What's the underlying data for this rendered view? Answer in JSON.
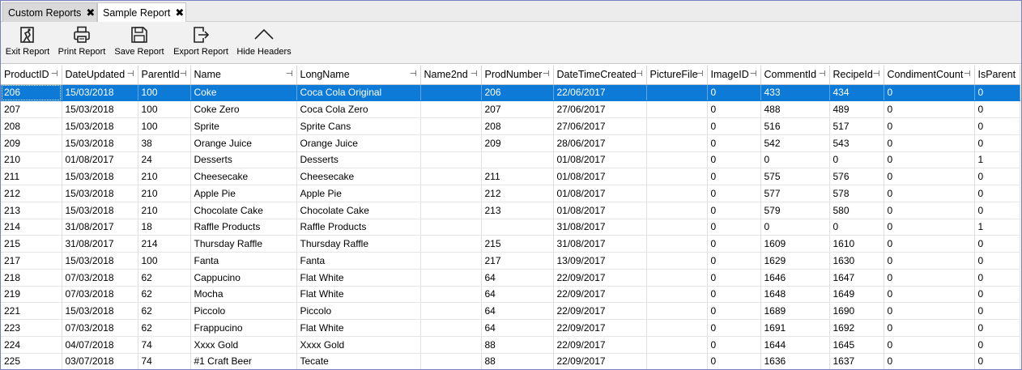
{
  "tabs": [
    {
      "label": "Custom Reports",
      "close": "✖"
    },
    {
      "label": "Sample Report",
      "close": "✖"
    }
  ],
  "toolbar": {
    "exit_label": "Exit Report",
    "print_label": "Print Report",
    "save_label": "Save Report",
    "export_label": "Export Report",
    "hide_label": "Hide Headers"
  },
  "grid": {
    "pin_glyph": "⊣",
    "columns": [
      "ProductID",
      "DateUpdated",
      "ParentId",
      "Name",
      "LongName",
      "Name2nd",
      "ProdNumber",
      "DateTimeCreated",
      "PictureFile",
      "ImageID",
      "CommentId",
      "RecipeId",
      "CondimentCount",
      "IsParent"
    ],
    "selected_row": 0,
    "rows": [
      [
        "206",
        "15/03/2018",
        "100",
        "Coke",
        "Coca Cola Original",
        "",
        "206",
        "22/06/2017",
        "",
        "0",
        "433",
        "434",
        "0",
        "0"
      ],
      [
        "207",
        "15/03/2018",
        "100",
        "Coke Zero",
        "Coca Cola Zero",
        "",
        "207",
        "27/06/2017",
        "",
        "0",
        "488",
        "489",
        "0",
        "0"
      ],
      [
        "208",
        "15/03/2018",
        "100",
        "Sprite",
        "Sprite Cans",
        "",
        "208",
        "27/06/2017",
        "",
        "0",
        "516",
        "517",
        "0",
        "0"
      ],
      [
        "209",
        "15/03/2018",
        "38",
        "Orange Juice",
        "Orange Juice",
        "",
        "209",
        "28/06/2017",
        "",
        "0",
        "542",
        "543",
        "0",
        "0"
      ],
      [
        "210",
        "01/08/2017",
        "24",
        "Desserts",
        "Desserts",
        "",
        "",
        "01/08/2017",
        "",
        "0",
        "0",
        "0",
        "0",
        "1"
      ],
      [
        "211",
        "15/03/2018",
        "210",
        "Cheesecake",
        "Cheesecake",
        "",
        "211",
        "01/08/2017",
        "",
        "0",
        "575",
        "576",
        "0",
        "0"
      ],
      [
        "212",
        "15/03/2018",
        "210",
        "Apple Pie",
        "Apple Pie",
        "",
        "212",
        "01/08/2017",
        "",
        "0",
        "577",
        "578",
        "0",
        "0"
      ],
      [
        "213",
        "15/03/2018",
        "210",
        "Chocolate Cake",
        "Chocolate Cake",
        "",
        "213",
        "01/08/2017",
        "",
        "0",
        "579",
        "580",
        "0",
        "0"
      ],
      [
        "214",
        "31/08/2017",
        "18",
        "Raffle Products",
        "Raffle Products",
        "",
        "",
        "31/08/2017",
        "",
        "0",
        "0",
        "0",
        "0",
        "1"
      ],
      [
        "215",
        "31/08/2017",
        "214",
        "Thursday Raffle",
        "Thursday Raffle",
        "",
        "215",
        "31/08/2017",
        "",
        "0",
        "1609",
        "1610",
        "0",
        "0"
      ],
      [
        "217",
        "15/03/2018",
        "100",
        "Fanta",
        "Fanta",
        "",
        "217",
        "13/09/2017",
        "",
        "0",
        "1629",
        "1630",
        "0",
        "0"
      ],
      [
        "218",
        "07/03/2018",
        "62",
        "Cappucino",
        "Flat White",
        "",
        "64",
        "22/09/2017",
        "",
        "0",
        "1646",
        "1647",
        "0",
        "0"
      ],
      [
        "219",
        "07/03/2018",
        "62",
        "Mocha",
        "Flat White",
        "",
        "64",
        "22/09/2017",
        "",
        "0",
        "1648",
        "1649",
        "0",
        "0"
      ],
      [
        "221",
        "15/03/2018",
        "62",
        "Piccolo",
        "Piccolo",
        "",
        "64",
        "22/09/2017",
        "",
        "0",
        "1689",
        "1690",
        "0",
        "0"
      ],
      [
        "223",
        "07/03/2018",
        "62",
        "Frappucino",
        "Flat White",
        "",
        "64",
        "22/09/2017",
        "",
        "0",
        "1691",
        "1692",
        "0",
        "0"
      ],
      [
        "224",
        "04/07/2018",
        "74",
        "Xxxx Gold",
        "Xxxx Gold",
        "",
        "88",
        "22/09/2017",
        "",
        "0",
        "1644",
        "1645",
        "0",
        "0"
      ],
      [
        "225",
        "03/07/2018",
        "74",
        "#1 Craft Beer",
        "Tecate",
        "",
        "88",
        "22/09/2017",
        "",
        "0",
        "1636",
        "1637",
        "0",
        "0"
      ]
    ]
  },
  "colors": {
    "selection": "#0c7ad6",
    "frame_border": "#7a7fc4"
  }
}
